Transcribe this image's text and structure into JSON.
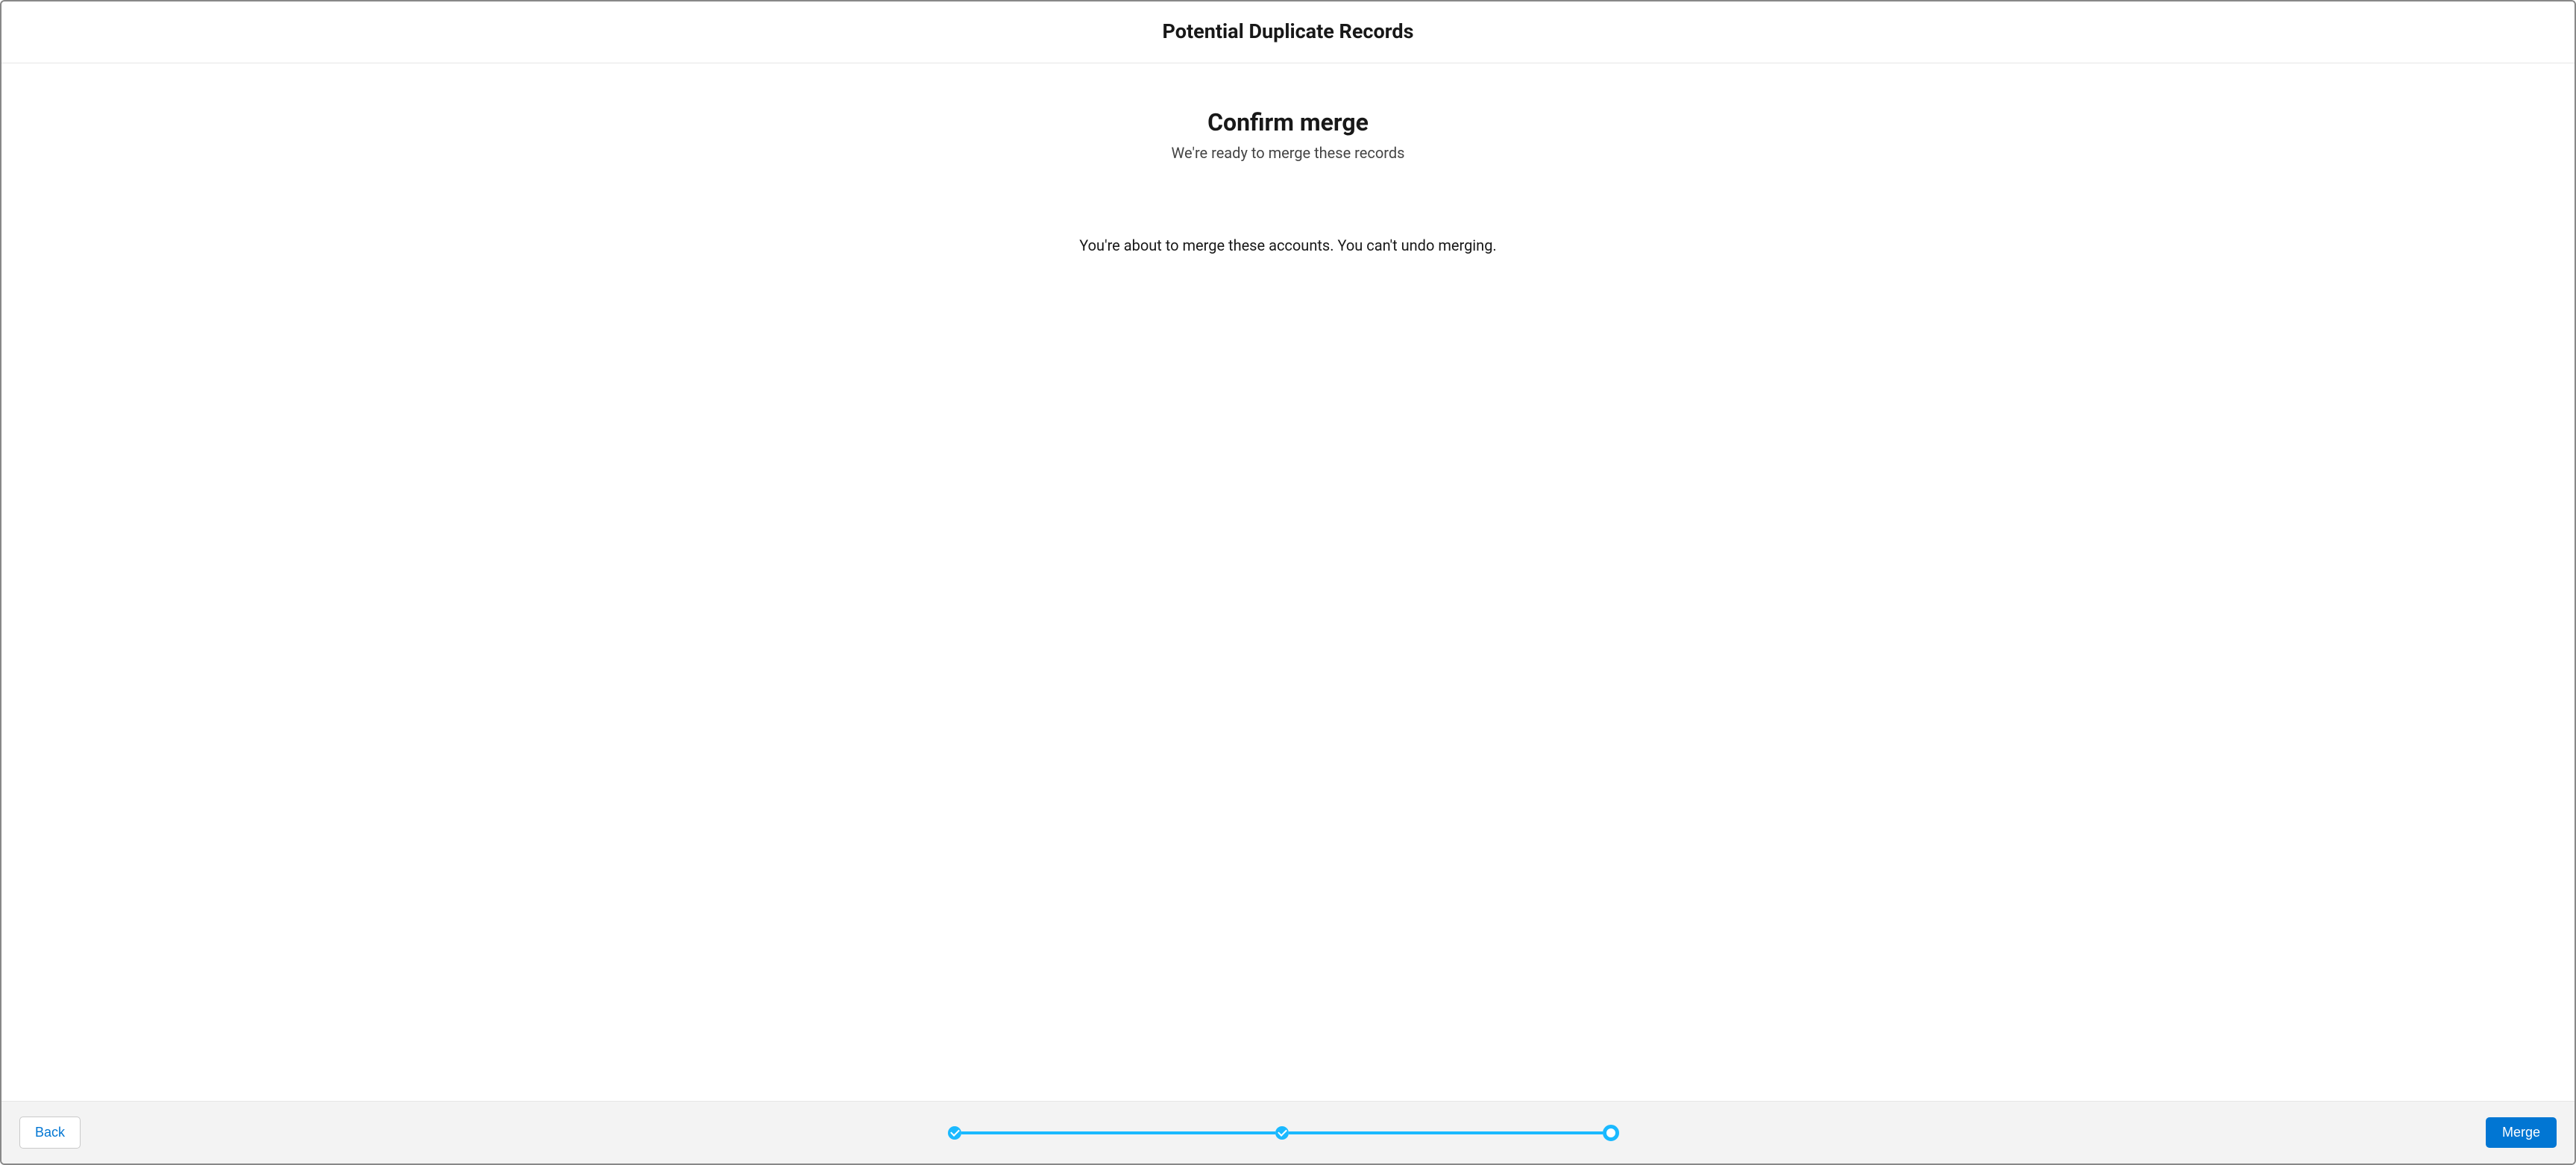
{
  "header": {
    "title": "Potential Duplicate Records"
  },
  "body": {
    "heading": "Confirm merge",
    "subtitle": "We're ready to merge these records",
    "warning": "You're about to merge these accounts. You can't undo merging."
  },
  "footer": {
    "back_label": "Back",
    "merge_label": "Merge"
  },
  "progress": {
    "total_steps": 3,
    "completed_steps": 2,
    "current_step": 3
  }
}
